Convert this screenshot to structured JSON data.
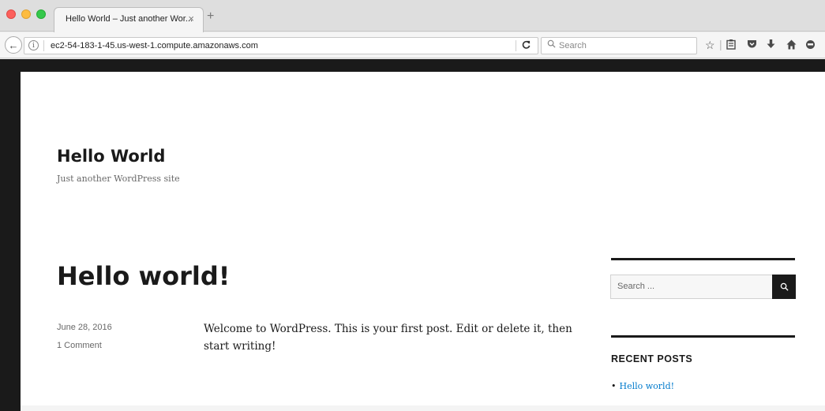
{
  "browser": {
    "tab_title": "Hello World – Just another Wor...",
    "tab_close": "×",
    "new_tab": "+",
    "url": "ec2-54-183-1-45.us-west-1.compute.amazonaws.com",
    "search_placeholder": "Search",
    "icons": {
      "back": "←",
      "info": "i",
      "reload": "C",
      "search": "🔍",
      "bookmark": "☆",
      "reading_list": "▤",
      "pocket": "◘",
      "download": "↓",
      "home": "⌂",
      "chat": "☻"
    },
    "colors": {
      "close": "#fc605c",
      "minimize": "#fdbc40",
      "maximize": "#34c84a"
    }
  },
  "site": {
    "title": "Hello World",
    "description": "Just another WordPress site"
  },
  "post": {
    "title": "Hello world!",
    "date": "June 28, 2016",
    "comments": "1 Comment",
    "body": "Welcome to WordPress. This is your first post. Edit or delete it, then start writing!"
  },
  "sidebar": {
    "search_placeholder": "Search ...",
    "search_icon": "magnifier-icon",
    "recent_posts_title": "RECENT POSTS",
    "recent_posts": [
      {
        "title": "Hello world!"
      }
    ],
    "link_color": "#007acc"
  }
}
